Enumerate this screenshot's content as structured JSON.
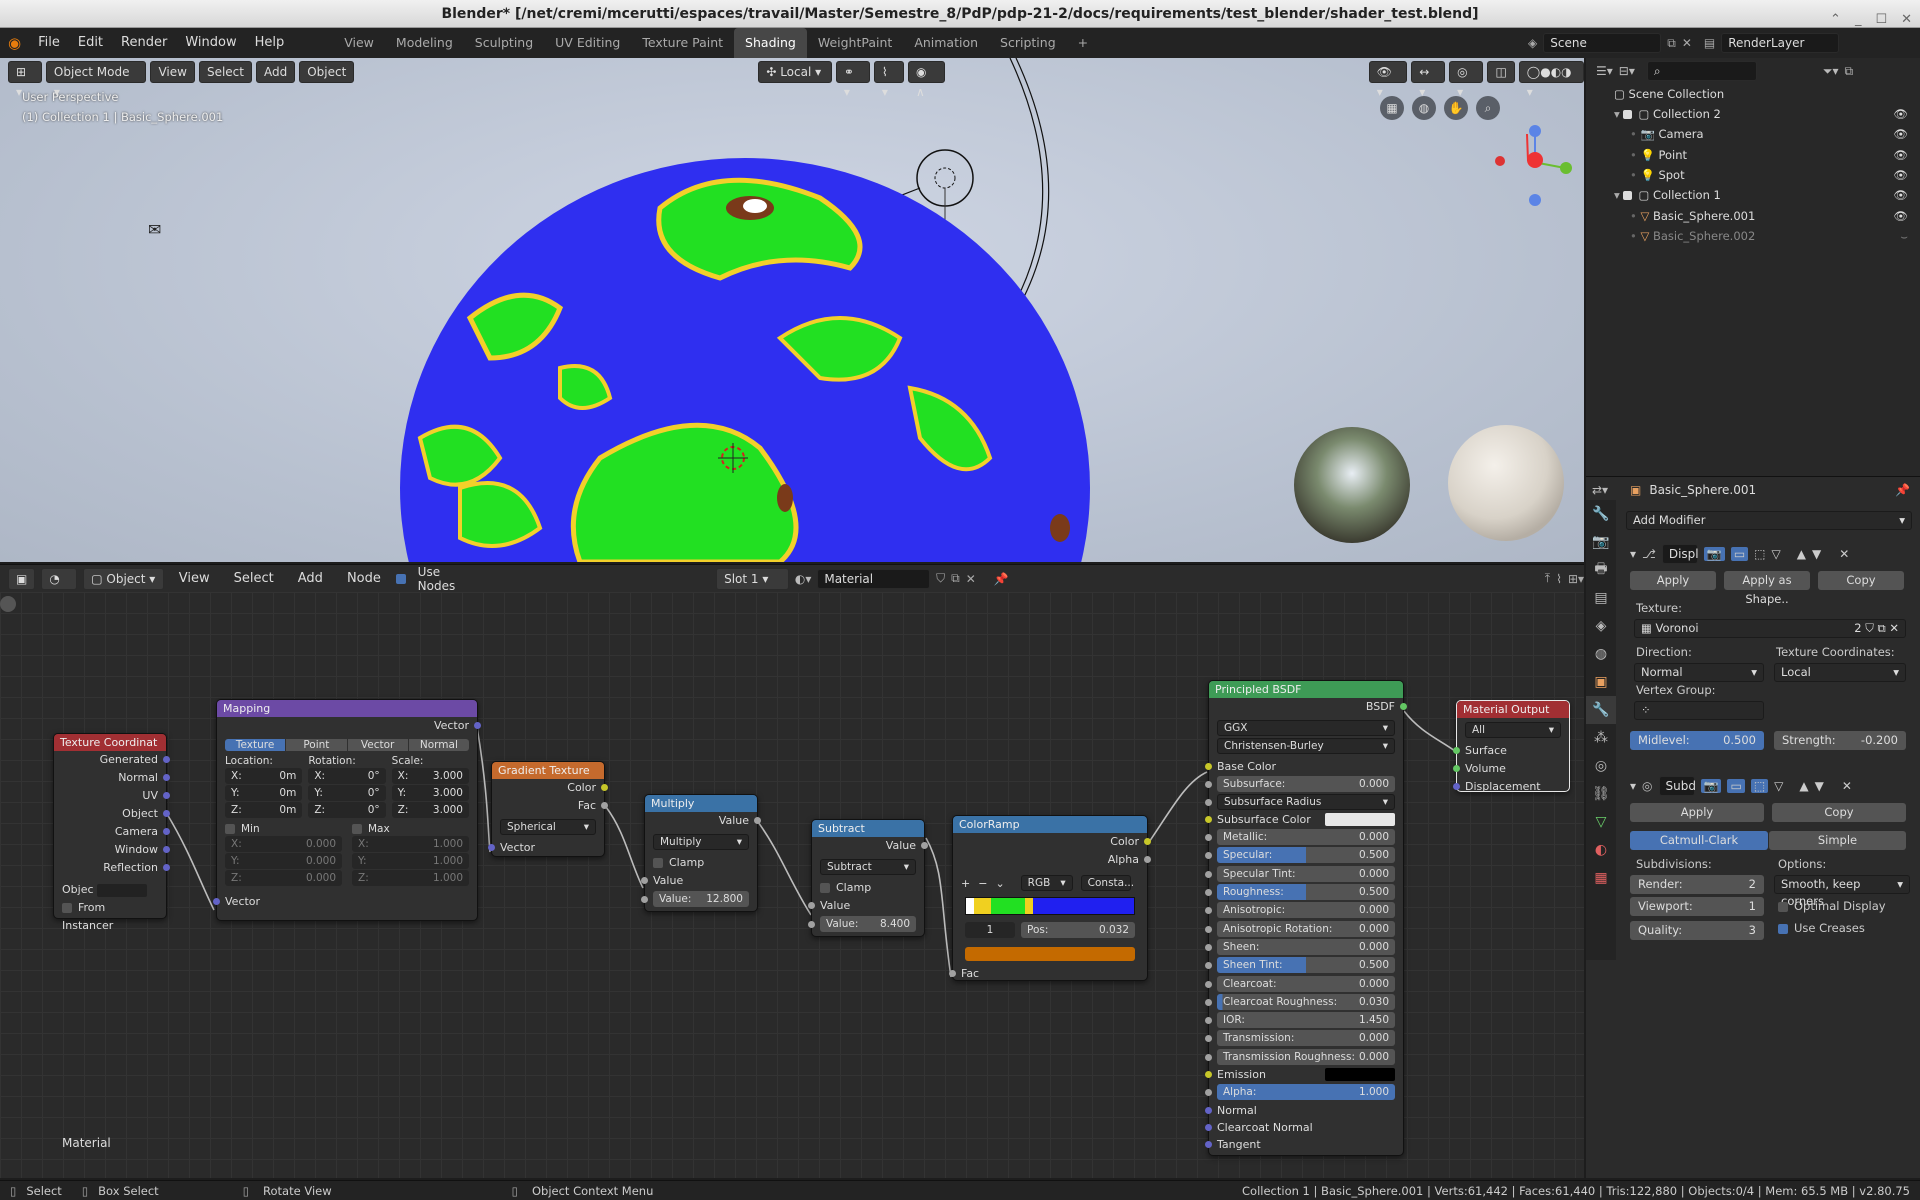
{
  "window": {
    "title": "Blender* [/net/cremi/mcerutti/espaces/travail/Master/Semestre_8/PdP/pdp-21-2/docs/requirements/test_blender/shader_test.blend]"
  },
  "menu": [
    "File",
    "Edit",
    "Render",
    "Window",
    "Help"
  ],
  "workspaces": [
    "View",
    "Modeling",
    "Sculpting",
    "UV Editing",
    "Texture Paint",
    "Shading",
    "WeightPaint",
    "Animation",
    "Scripting"
  ],
  "active_workspace": "Shading",
  "scene": "Scene",
  "view_layer": "RenderLayer",
  "viewport": {
    "mode": "Object Mode",
    "view": "View",
    "select": "Select",
    "add": "Add",
    "object": "Object",
    "orientation": "Local",
    "info_line1": "User Perspective",
    "info_line2": "(1) Collection 1 | Basic_Sphere.001",
    "axes": {
      "x": "X",
      "y": "Y",
      "z": "Z"
    }
  },
  "node_header": {
    "editor": "Object",
    "view": "View",
    "select": "Select",
    "add": "Add",
    "node": "Node",
    "use_nodes": "Use Nodes",
    "slot": "Slot 1",
    "material": "Material"
  },
  "nodes": {
    "texcoord": {
      "title": "Texture Coordinat",
      "outputs": [
        "Generated",
        "Normal",
        "UV",
        "Object",
        "Camera",
        "Window",
        "Reflection"
      ],
      "object_label": "Objec",
      "from_instancer": "From Instancer"
    },
    "mapping": {
      "title": "Mapping",
      "output": "Vector",
      "tabs": [
        "Texture",
        "Point",
        "Vector",
        "Normal"
      ],
      "loc_label": "Location:",
      "rot_label": "Rotation:",
      "scale_label": "Scale:",
      "loc": [
        "0m",
        "0m",
        "0m"
      ],
      "rot": [
        "0°",
        "0°",
        "0°"
      ],
      "scale": [
        "3.000",
        "3.000",
        "3.000"
      ],
      "axes": [
        "X:",
        "Y:",
        "Z:"
      ],
      "min": "Min",
      "max": "Max",
      "min_vals": [
        "0.000",
        "0.000",
        "0.000"
      ],
      "max_vals": [
        "1.000",
        "1.000",
        "1.000"
      ],
      "input": "Vector"
    },
    "gradient": {
      "title": "Gradient Texture",
      "outputs": [
        "Color",
        "Fac"
      ],
      "type": "Spherical",
      "input": "Vector"
    },
    "multiply": {
      "title": "Multiply",
      "output": "Value",
      "op": "Multiply",
      "clamp": "Clamp",
      "input": "Value",
      "value_label": "Value:",
      "value": "12.800"
    },
    "subtract": {
      "title": "Subtract",
      "output": "Value",
      "op": "Subtract",
      "clamp": "Clamp",
      "input": "Value",
      "value_label": "Value:",
      "value": "8.400"
    },
    "colorramp": {
      "title": "ColorRamp",
      "outputs": [
        "Color",
        "Alpha"
      ],
      "mode": "RGB",
      "interp": "Consta...",
      "index": "1",
      "pos_label": "Pos:",
      "pos": "0.032",
      "input": "Fac",
      "stop_color": "#c46a00"
    },
    "bsdf": {
      "title": "Principled BSDF",
      "output": "BSDF",
      "dist": "GGX",
      "sss_method": "Christensen-Burley",
      "rows": [
        {
          "label": "Base Color",
          "type": "label"
        },
        {
          "label": "Subsurface:",
          "value": "0.000",
          "fill": 0
        },
        {
          "label": "Subsurface Radius",
          "type": "drop"
        },
        {
          "label": "Subsurface Color",
          "type": "color",
          "color": "#e8e8e8"
        },
        {
          "label": "Metallic:",
          "value": "0.000",
          "fill": 0
        },
        {
          "label": "Specular:",
          "value": "0.500",
          "fill": 50
        },
        {
          "label": "Specular Tint:",
          "value": "0.000",
          "fill": 0
        },
        {
          "label": "Roughness:",
          "value": "0.500",
          "fill": 50
        },
        {
          "label": "Anisotropic:",
          "value": "0.000",
          "fill": 0
        },
        {
          "label": "Anisotropic Rotation:",
          "value": "0.000",
          "fill": 0
        },
        {
          "label": "Sheen:",
          "value": "0.000",
          "fill": 0
        },
        {
          "label": "Sheen Tint:",
          "value": "0.500",
          "fill": 50
        },
        {
          "label": "Clearcoat:",
          "value": "0.000",
          "fill": 0
        },
        {
          "label": "Clearcoat Roughness:",
          "value": "0.030",
          "fill": 3
        },
        {
          "label": "IOR:",
          "value": "1.450",
          "fill": 0
        },
        {
          "label": "Transmission:",
          "value": "0.000",
          "fill": 0
        },
        {
          "label": "Transmission Roughness:",
          "value": "0.000",
          "fill": 0
        },
        {
          "label": "Emission",
          "type": "color",
          "color": "#000000"
        },
        {
          "label": "Alpha:",
          "value": "1.000",
          "fill": 100
        },
        {
          "label": "Normal",
          "type": "label"
        },
        {
          "label": "Clearcoat Normal",
          "type": "label"
        },
        {
          "label": "Tangent",
          "type": "label"
        }
      ]
    },
    "output": {
      "title": "Material Output",
      "target": "All",
      "inputs": [
        "Surface",
        "Volume",
        "Displacement"
      ]
    }
  },
  "node_tree_label": "Material",
  "outliner": {
    "scene_collection": "Scene Collection",
    "items": [
      {
        "name": "Collection 2",
        "kind": "collection"
      },
      {
        "name": "Camera",
        "kind": "camera"
      },
      {
        "name": "Point",
        "kind": "light"
      },
      {
        "name": "Spot",
        "kind": "light"
      },
      {
        "name": "Collection 1",
        "kind": "collection"
      },
      {
        "name": "Basic_Sphere.001",
        "kind": "mesh"
      },
      {
        "name": "Basic_Sphere.002",
        "kind": "mesh"
      }
    ]
  },
  "properties": {
    "object": "Basic_Sphere.001",
    "add_modifier": "Add Modifier",
    "displace": {
      "name": "Displ",
      "apply": "Apply",
      "apply_shape": "Apply as Shape..",
      "copy": "Copy",
      "texture_label": "Texture:",
      "texture": "Voronoi",
      "users": "2",
      "direction_label": "Direction:",
      "direction": "Normal",
      "coords_label": "Texture Coordinates:",
      "coords": "Local",
      "vgroup_label": "Vertex Group:",
      "midlevel_label": "Midlevel:",
      "midlevel": "0.500",
      "strength_label": "Strength:",
      "strength": "-0.200"
    },
    "subsurf": {
      "name": "Subd",
      "apply": "Apply",
      "copy": "Copy",
      "catmull": "Catmull-Clark",
      "simple": "Simple",
      "subdiv_label": "Subdivisions:",
      "options_label": "Options:",
      "render_label": "Render:",
      "render": "2",
      "viewport_label": "Viewport:",
      "viewport": "1",
      "quality_label": "Quality:",
      "quality": "3",
      "uv_smooth": "Smooth, keep corners",
      "optimal": "Optimal Display",
      "creases": "Use Creases"
    }
  },
  "status": {
    "select": "Select",
    "box_select": "Box Select",
    "rotate": "Rotate View",
    "context": "Object Context Menu",
    "stats": "Collection 1 | Basic_Sphere.001 | Verts:61,442 | Faces:61,440 | Tris:122,880 | Objects:0/4 | Mem: 65.5 MB | v2.80.75"
  }
}
